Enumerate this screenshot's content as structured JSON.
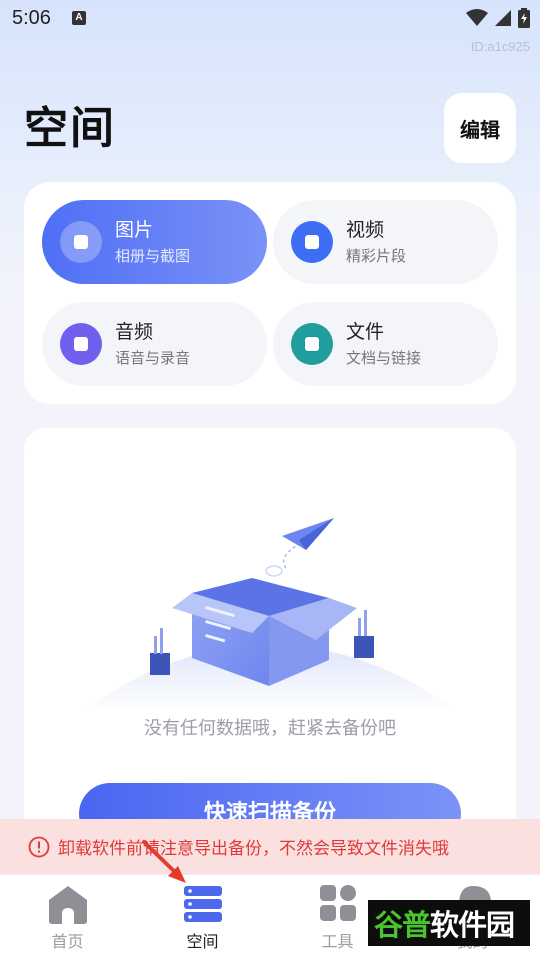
{
  "status_bar": {
    "time": "5:06",
    "notification": "A"
  },
  "device_id": "ID:a1c925",
  "header": {
    "title": "空间",
    "edit_label": "编辑"
  },
  "categories": [
    {
      "title": "图片",
      "subtitle": "相册与截图",
      "color": "#5a78f5",
      "active": true
    },
    {
      "title": "视频",
      "subtitle": "精彩片段",
      "color": "#3d6df2",
      "active": false
    },
    {
      "title": "音频",
      "subtitle": "语音与录音",
      "color": "#7060ee",
      "active": false
    },
    {
      "title": "文件",
      "subtitle": "文档与链接",
      "color": "#1e9e9e",
      "active": false
    }
  ],
  "empty_state": {
    "message": "没有任何数据哦，赶紧去备份吧",
    "button_label": "快速扫描备份"
  },
  "warning": {
    "message": "卸载软件前请注意导出备份，不然会导致文件消失哦",
    "color": "#e03a3a"
  },
  "tabs": [
    {
      "label": "首页",
      "icon": "home-icon",
      "active": false
    },
    {
      "label": "空间",
      "icon": "space-list-icon",
      "active": true
    },
    {
      "label": "工具",
      "icon": "tools-grid-icon",
      "active": false
    },
    {
      "label": "我的",
      "icon": "profile-icon",
      "active": false
    }
  ],
  "watermark": {
    "green": "谷普",
    "white": "软件园"
  },
  "colors": {
    "accent": "#4f6ff5",
    "tab_active": "#4c68ee",
    "tab_inactive": "#9a9da6"
  }
}
